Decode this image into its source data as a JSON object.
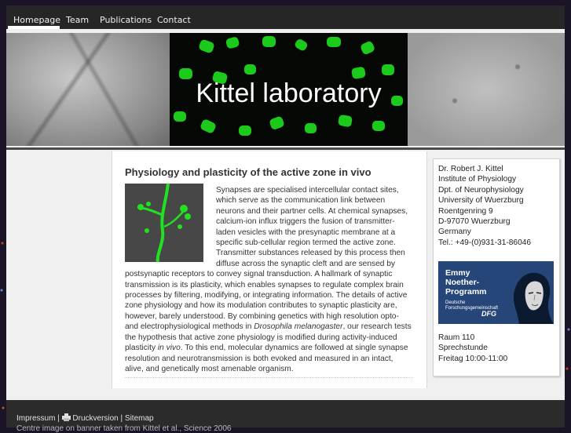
{
  "nav": {
    "items": [
      {
        "label": "Homepage"
      },
      {
        "label": "Team"
      },
      {
        "label": "Publications"
      },
      {
        "label": "Contact"
      }
    ]
  },
  "banner": {
    "title": "Kittel laboratory"
  },
  "main": {
    "title": "Physiology and plasticity of the active zone in vivo",
    "text_a": "Synapses are specialised intercellular contact sites, which serve as the communication link between neurons and their partner cells. At chemical synapses, calcium-ion influx triggers the fusion of transmitter-laden vesicles with the presynaptic membrane at a specific sub-cellular region termed the active zone. Transmitter substances released by this process then diffuse across the synaptic cleft and are sensed by postsynaptic receptors to convey signal transduction. A hallmark of synaptic transmission is its plasticity, which enables synapses to regulate complex brain processes by filtering, modifying, or integrating information. The details of active zone physiology and how its modulation contributes to synaptic plasticity are, however, barely understood. By combining genetics with high resolution opto- and electrophysiological methods in ",
    "text_italic_1": "Drosophila melanogaster",
    "text_b": ", our research tests the hypothesis that active zone physiology is modified during activity-induced plasticity ",
    "text_italic_2": "in vivo",
    "text_c": ". To this end, molecular dynamics are followed at single synapse resolution and neurotransmission is both evoked and measured in an intact, alive, and genetically most amenable organism."
  },
  "sidebar": {
    "address": [
      "Dr. Robert J. Kittel",
      "Institute of Physiology",
      "Dpt. of Neurophysiology",
      "University of Wuerzburg",
      "Roentgenring 9",
      "D-97070 Wuerzburg",
      "Germany",
      "Tel.: +49-(0)931-31-86046"
    ],
    "emmy": {
      "line1": "Emmy",
      "line2": "Noether-",
      "line3": "Programm",
      "sub1": "Deutsche",
      "sub2": "Forschungsgemeinschaft",
      "dfg": "DFG"
    },
    "office": [
      "Raum 110",
      "Sprechstunde",
      "Freitag 10:00-11:00"
    ]
  },
  "footer": {
    "impressum": "Impressum",
    "sep1": " | ",
    "druck": "Druckversion",
    "sep2": " | ",
    "sitemap": "Sitemap",
    "credit": "Centre image on banner taken from Kittel et al., Science 2006"
  },
  "colors": {
    "nav_bg": "#262626",
    "footer_bg": "#2b2b2b",
    "emmy_blue": "#26467a",
    "microscopy_green": "#1ee01e"
  }
}
